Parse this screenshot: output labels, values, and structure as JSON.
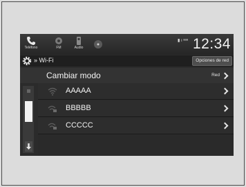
{
  "statusbar": {
    "phone_label": "Teléfono",
    "fm_label": "FM",
    "audio_label": "Audio",
    "signal_text": "▮ ı ᵃᵃᵃ",
    "clock": "12:34"
  },
  "titlebar": {
    "breadcrumb": "Wi-Fi",
    "options_label": "Opciones de red"
  },
  "mode": {
    "label": "Cambiar modo",
    "value": "Red"
  },
  "networks": [
    {
      "ssid": "AAAAA",
      "icon": "wifi-icon"
    },
    {
      "ssid": "BBBBB",
      "icon": "wifi-locked-icon"
    },
    {
      "ssid": "CCCCC",
      "icon": "wifi-locked-icon"
    }
  ],
  "colors": {
    "screen_bg": "#2b2b2b",
    "text": "#f4f4f4",
    "frame_bg": "#dcdcdc"
  }
}
